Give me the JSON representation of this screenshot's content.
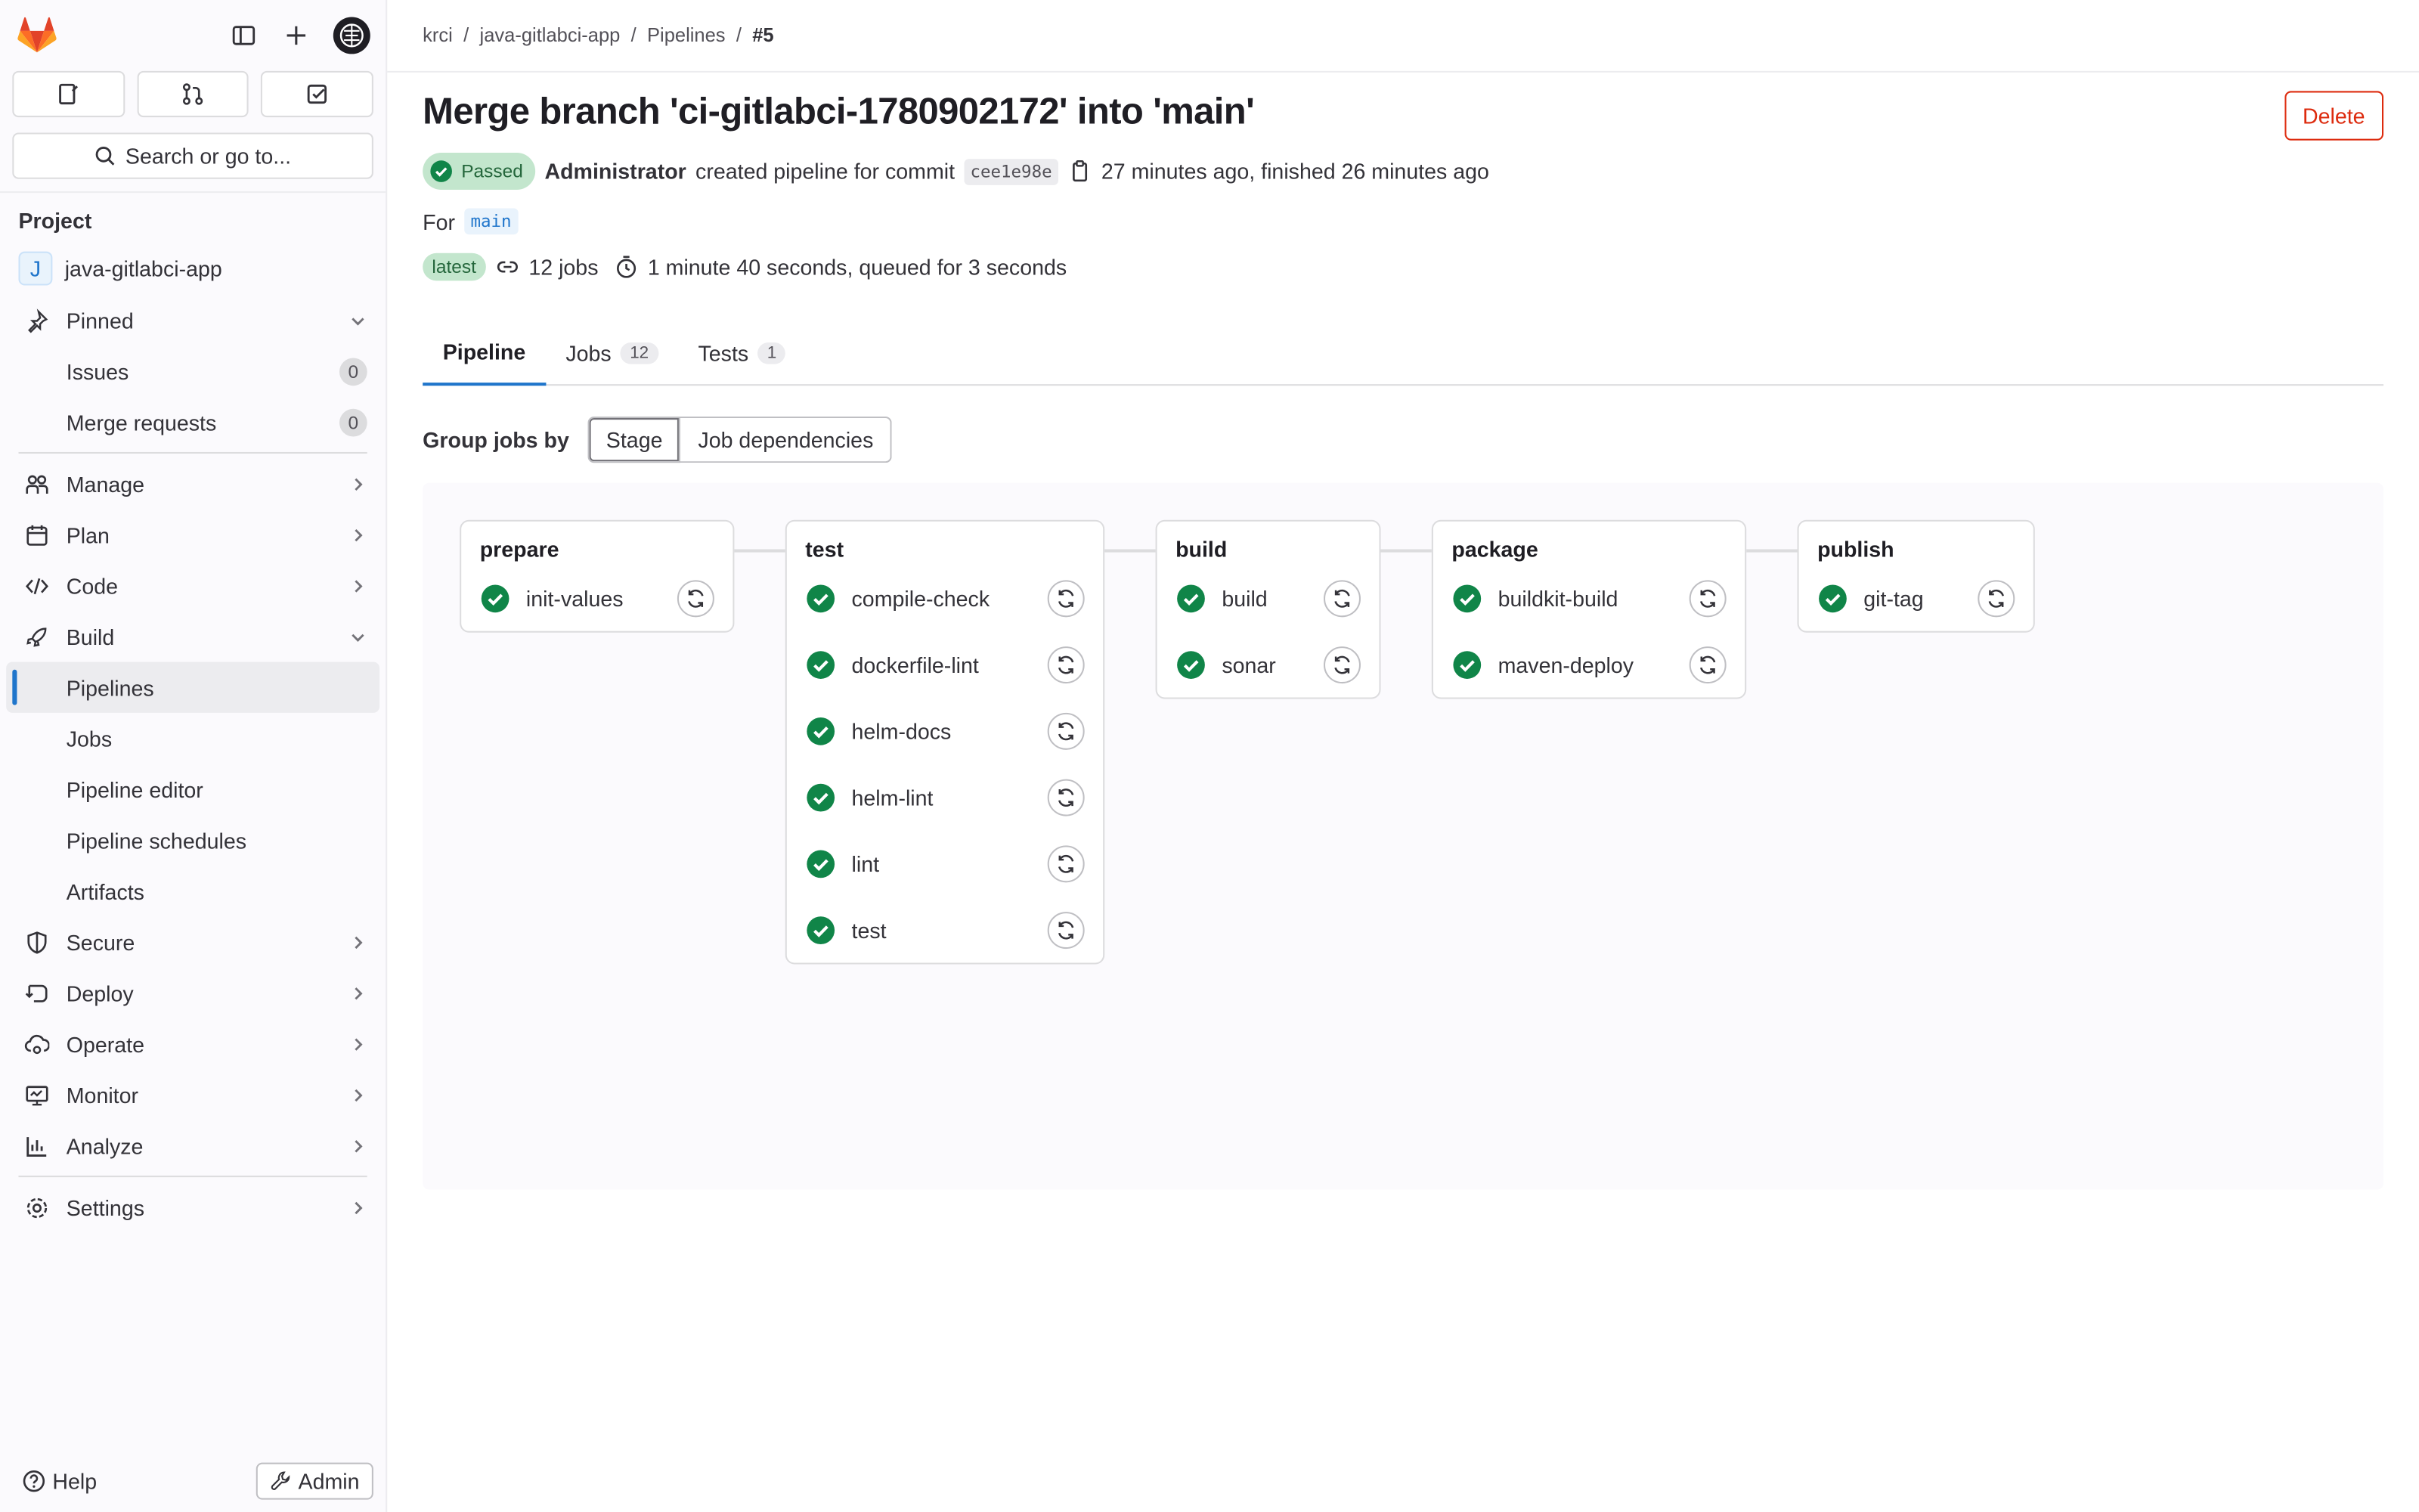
{
  "colors": {
    "accent": "#1f75cb",
    "success": "#108548",
    "danger": "#dd2b0e"
  },
  "sidebar": {
    "search_label": "Search or go to...",
    "section_title": "Project",
    "project_initial": "J",
    "project_name": "java-gitlabci-app",
    "pinned": {
      "label": "Pinned",
      "items": [
        {
          "label": "Issues",
          "count": "0"
        },
        {
          "label": "Merge requests",
          "count": "0"
        }
      ]
    },
    "manage": "Manage",
    "plan": "Plan",
    "code": "Code",
    "build": {
      "label": "Build",
      "items": [
        "Pipelines",
        "Jobs",
        "Pipeline editor",
        "Pipeline schedules",
        "Artifacts"
      ]
    },
    "secure": "Secure",
    "deploy": "Deploy",
    "operate": "Operate",
    "monitor": "Monitor",
    "analyze": "Analyze",
    "settings": "Settings",
    "help": "Help",
    "admin": "Admin"
  },
  "breadcrumb": [
    "krci",
    "java-gitlabci-app",
    "Pipelines",
    "#5"
  ],
  "pipeline": {
    "title": "Merge branch 'ci-gitlabci-1780902172' into 'main'",
    "delete_label": "Delete",
    "status": "Passed",
    "author": "Administrator",
    "created_text": "created pipeline for commit",
    "commit": "cee1e98e",
    "time_text": "27 minutes ago, finished 26 minutes ago",
    "for_label": "For",
    "ref": "main",
    "latest_badge": "latest",
    "jobs_text": "12 jobs",
    "duration_text": "1 minute 40 seconds, queued for 3 seconds"
  },
  "tabs": [
    {
      "label": "Pipeline"
    },
    {
      "label": "Jobs",
      "count": "12"
    },
    {
      "label": "Tests",
      "count": "1"
    }
  ],
  "group_by": {
    "label": "Group jobs by",
    "options": [
      "Stage",
      "Job dependencies"
    ]
  },
  "stages": [
    {
      "name": "prepare",
      "jobs": [
        "init-values"
      ]
    },
    {
      "name": "test",
      "jobs": [
        "compile-check",
        "dockerfile-lint",
        "helm-docs",
        "helm-lint",
        "lint",
        "test"
      ]
    },
    {
      "name": "build",
      "jobs": [
        "build",
        "sonar"
      ]
    },
    {
      "name": "package",
      "jobs": [
        "buildkit-build",
        "maven-deploy"
      ]
    },
    {
      "name": "publish",
      "jobs": [
        "git-tag"
      ]
    }
  ]
}
